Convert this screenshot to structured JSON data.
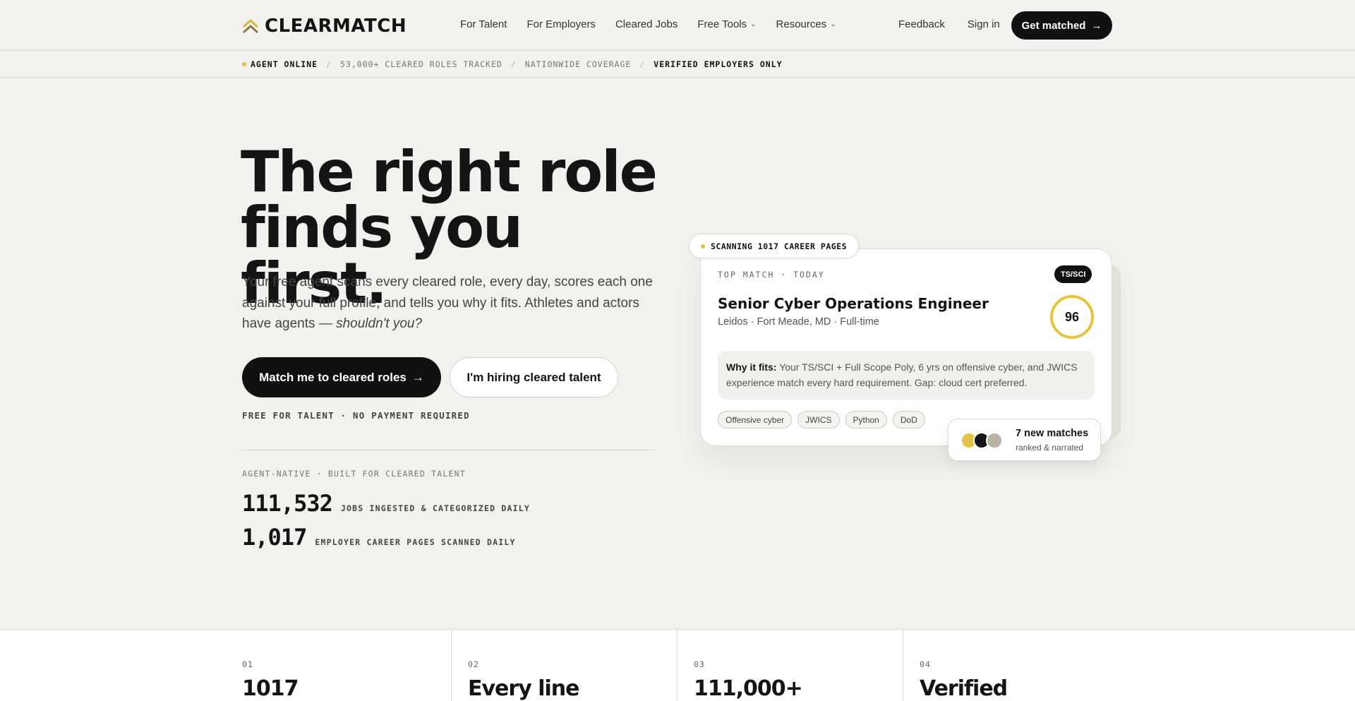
{
  "header": {
    "brand": "CLEARMATCH",
    "nav": [
      {
        "label": "For Talent",
        "dropdown": false
      },
      {
        "label": "For Employers",
        "dropdown": false
      },
      {
        "label": "Cleared Jobs",
        "dropdown": false
      },
      {
        "label": "Free Tools",
        "dropdown": true
      },
      {
        "label": "Resources",
        "dropdown": true
      }
    ],
    "feedback": "Feedback",
    "signin": "Sign in",
    "cta": "Get matched",
    "cta_arrow": "→"
  },
  "ticker": {
    "status": "AGENT ONLINE",
    "roles": "53,000+ CLEARED ROLES TRACKED",
    "coverage": "NATIONWIDE COVERAGE",
    "verified": "VERIFIED EMPLOYERS ONLY",
    "separator": "/"
  },
  "hero": {
    "title_line1": "The right role",
    "title_line2": "finds you first.",
    "subtitle": "Your free agent scans every cleared role, every day, scores each one against your full profile, and tells you why it fits. Athletes and actors have agents —",
    "subtitle_em": "shouldn't you?",
    "primary_cta": "Match me to cleared roles",
    "primary_arrow": "→",
    "secondary_cta": "I'm hiring cleared talent",
    "free_note": "FREE FOR TALENT · NO PAYMENT REQUIRED",
    "stats_label": "AGENT-NATIVE · BUILT FOR CLEARED TALENT",
    "stats": [
      {
        "value": "111,532",
        "label": "JOBS INGESTED & CATEGORIZED DAILY"
      },
      {
        "value": "1,017",
        "label": "EMPLOYER CAREER PAGES SCANNED DAILY"
      }
    ]
  },
  "card": {
    "scan_pill": "SCANNING 1017 CAREER PAGES",
    "label": "TOP MATCH · TODAY",
    "badge": "TS/SCI",
    "job_title": "Senior Cyber Operations Engineer",
    "job_meta": "Leidos · Fort Meade, MD · Full-time",
    "score": "96",
    "why_label": "Why it fits:",
    "why_text": "Your TS/SCI + Full Scope Poly, 6 yrs on offensive cyber, and JWICS experience match every hard requirement. Gap: cloud cert preferred.",
    "tags": [
      "Offensive cyber",
      "JWICS",
      "Python",
      "DoD"
    ],
    "matches_title": "7 new matches",
    "matches_sub": "ranked & narrated"
  },
  "strip": [
    {
      "num": "01",
      "value": "1017"
    },
    {
      "num": "02",
      "value": "Every line"
    },
    {
      "num": "03",
      "value": "111,000+"
    },
    {
      "num": "04",
      "value": "Verified"
    }
  ],
  "colors": {
    "accent": "#e7c33a",
    "background": "#f3f1ed",
    "ink": "#141414"
  }
}
